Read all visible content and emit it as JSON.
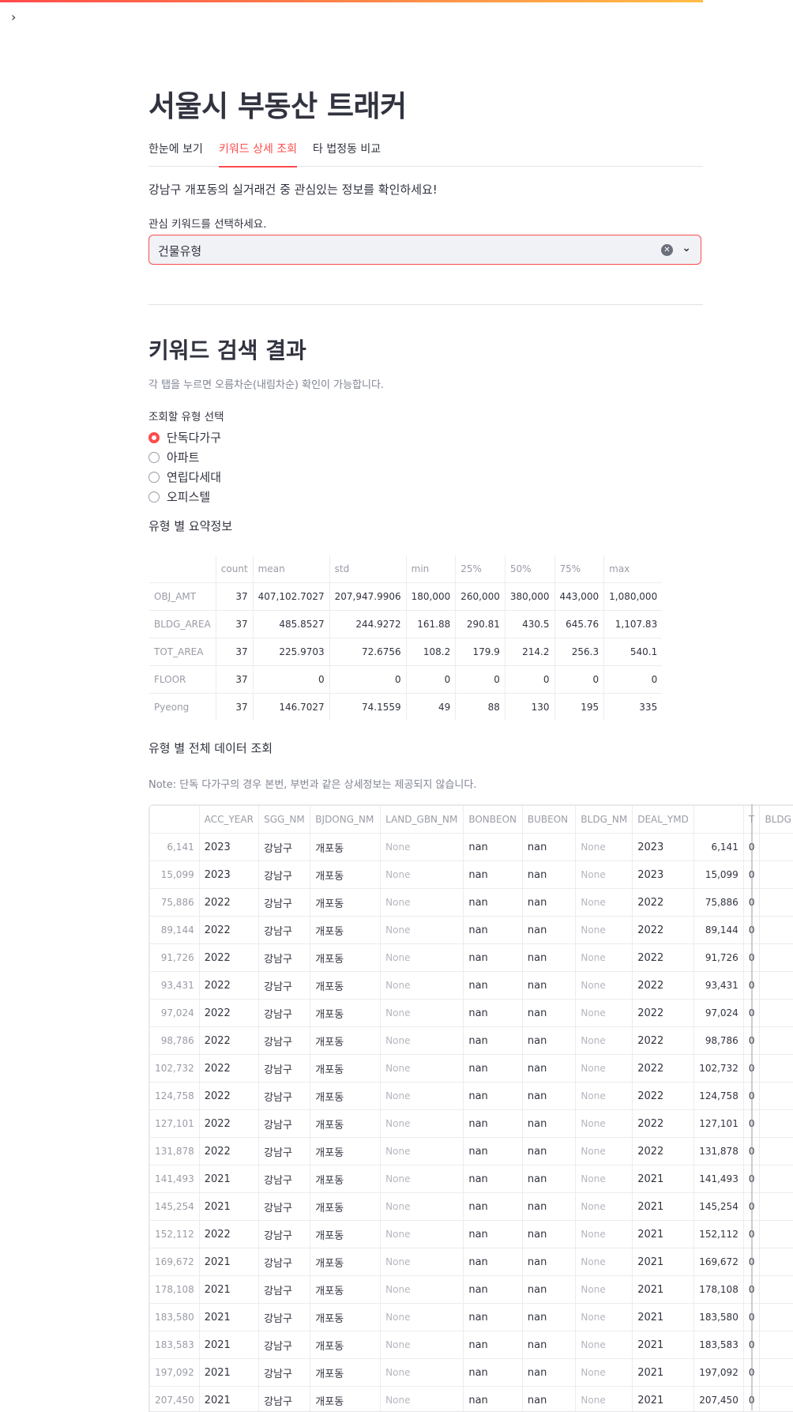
{
  "app": {
    "sidebar_toggle": "›"
  },
  "title": "서울시 부동산 트래커",
  "tabs": [
    "한눈에 보기",
    "키워드 상세 조회",
    "타 법정동 비교"
  ],
  "intro_text": "강남구 개포동의 실거래건 중 관심있는 정보를 확인하세요!",
  "keyword_select": {
    "label": "관심 키워드를 선택하세요.",
    "value": "건물유형"
  },
  "results_heading": "키워드 검색 결과",
  "results_caption": "각 탭을 누르면 오름차순(내림차순) 확인이 가능합니다.",
  "type_radio": {
    "label": "조회할 유형 선택",
    "options": [
      "단독다가구",
      "아파트",
      "연립다세대",
      "오피스텔"
    ],
    "selected": "단독다가구"
  },
  "summary": {
    "heading": "유형 별 요약정보",
    "columns": [
      "",
      "count",
      "mean",
      "std",
      "min",
      "25%",
      "50%",
      "75%",
      "max"
    ],
    "rows": [
      [
        "OBJ_AMT",
        "37",
        "407,102.7027",
        "207,947.9906",
        "180,000",
        "260,000",
        "380,000",
        "443,000",
        "1,080,000"
      ],
      [
        "BLDG_AREA",
        "37",
        "485.8527",
        "244.9272",
        "161.88",
        "290.81",
        "430.5",
        "645.76",
        "1,107.83"
      ],
      [
        "TOT_AREA",
        "37",
        "225.9703",
        "72.6756",
        "108.2",
        "179.9",
        "214.2",
        "256.3",
        "540.1"
      ],
      [
        "FLOOR",
        "37",
        "0",
        "0",
        "0",
        "0",
        "0",
        "0",
        "0"
      ],
      [
        "Pyeong",
        "37",
        "146.7027",
        "74.1559",
        "49",
        "88",
        "130",
        "195",
        "335"
      ]
    ]
  },
  "full_data": {
    "heading": "유형 별 전체 데이터 조회",
    "note": "Note: 단독 다가구의 경우 본번, 부번과 같은 상세정보는 제공되지 않습니다.",
    "columns": [
      "",
      "ACC_YEAR",
      "SGG_NM",
      "BJDONG_NM",
      "LAND_GBN_NM",
      "BONBEON",
      "BUBEON",
      "BLDG_NM",
      "DEAL_YMD",
      "",
      "T",
      "BLDG"
    ],
    "rows": [
      [
        "6,141",
        "2023",
        "강남구",
        "개포동",
        "None",
        "nan",
        "nan",
        "None",
        "2023",
        "6,141",
        "0",
        ""
      ],
      [
        "15,099",
        "2023",
        "강남구",
        "개포동",
        "None",
        "nan",
        "nan",
        "None",
        "2023",
        "15,099",
        "0",
        ""
      ],
      [
        "75,886",
        "2022",
        "강남구",
        "개포동",
        "None",
        "nan",
        "nan",
        "None",
        "2022",
        "75,886",
        "0",
        ""
      ],
      [
        "89,144",
        "2022",
        "강남구",
        "개포동",
        "None",
        "nan",
        "nan",
        "None",
        "2022",
        "89,144",
        "0",
        ""
      ],
      [
        "91,726",
        "2022",
        "강남구",
        "개포동",
        "None",
        "nan",
        "nan",
        "None",
        "2022",
        "91,726",
        "0",
        ""
      ],
      [
        "93,431",
        "2022",
        "강남구",
        "개포동",
        "None",
        "nan",
        "nan",
        "None",
        "2022",
        "93,431",
        "0",
        ""
      ],
      [
        "97,024",
        "2022",
        "강남구",
        "개포동",
        "None",
        "nan",
        "nan",
        "None",
        "2022",
        "97,024",
        "0",
        ""
      ],
      [
        "98,786",
        "2022",
        "강남구",
        "개포동",
        "None",
        "nan",
        "nan",
        "None",
        "2022",
        "98,786",
        "0",
        ""
      ],
      [
        "102,732",
        "2022",
        "강남구",
        "개포동",
        "None",
        "nan",
        "nan",
        "None",
        "2022",
        "102,732",
        "0",
        ""
      ],
      [
        "124,758",
        "2022",
        "강남구",
        "개포동",
        "None",
        "nan",
        "nan",
        "None",
        "2022",
        "124,758",
        "0",
        ""
      ],
      [
        "127,101",
        "2022",
        "강남구",
        "개포동",
        "None",
        "nan",
        "nan",
        "None",
        "2022",
        "127,101",
        "0",
        ""
      ],
      [
        "131,878",
        "2022",
        "강남구",
        "개포동",
        "None",
        "nan",
        "nan",
        "None",
        "2022",
        "131,878",
        "0",
        ""
      ],
      [
        "141,493",
        "2021",
        "강남구",
        "개포동",
        "None",
        "nan",
        "nan",
        "None",
        "2021",
        "141,493",
        "0",
        ""
      ],
      [
        "145,254",
        "2021",
        "강남구",
        "개포동",
        "None",
        "nan",
        "nan",
        "None",
        "2021",
        "145,254",
        "0",
        ""
      ],
      [
        "152,112",
        "2022",
        "강남구",
        "개포동",
        "None",
        "nan",
        "nan",
        "None",
        "2021",
        "152,112",
        "0",
        ""
      ],
      [
        "169,672",
        "2021",
        "강남구",
        "개포동",
        "None",
        "nan",
        "nan",
        "None",
        "2021",
        "169,672",
        "0",
        ""
      ],
      [
        "178,108",
        "2021",
        "강남구",
        "개포동",
        "None",
        "nan",
        "nan",
        "None",
        "2021",
        "178,108",
        "0",
        ""
      ],
      [
        "183,580",
        "2021",
        "강남구",
        "개포동",
        "None",
        "nan",
        "nan",
        "None",
        "2021",
        "183,580",
        "0",
        ""
      ],
      [
        "183,583",
        "2021",
        "강남구",
        "개포동",
        "None",
        "nan",
        "nan",
        "None",
        "2021",
        "183,583",
        "0",
        ""
      ],
      [
        "197,092",
        "2021",
        "강남구",
        "개포동",
        "None",
        "nan",
        "nan",
        "None",
        "2021",
        "197,092",
        "0",
        ""
      ],
      [
        "207,450",
        "2021",
        "강남구",
        "개포동",
        "None",
        "nan",
        "nan",
        "None",
        "2021",
        "207,450",
        "0",
        ""
      ]
    ]
  },
  "colors": {
    "accent": "#ff4b4b",
    "text": "#31333f",
    "muted": "#808495",
    "input_bg": "#f0f2f6"
  }
}
